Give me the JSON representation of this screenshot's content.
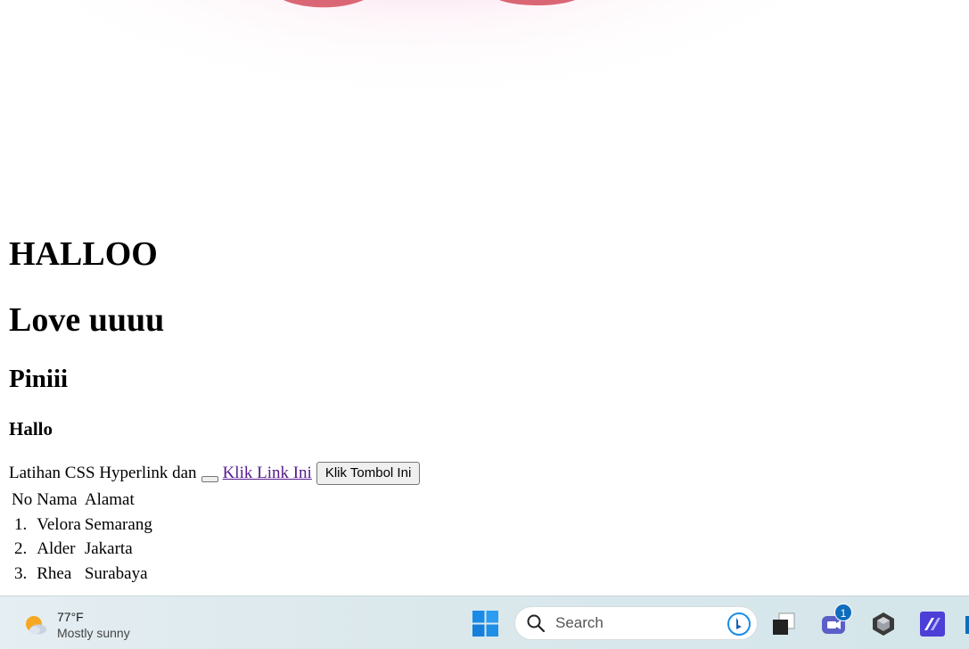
{
  "page": {
    "heading1": "HALLOO",
    "heading2": "Love uuuu",
    "heading3": "Piniii",
    "heading4": "Hallo",
    "intro_text": "Latihan CSS Hyperlink dan",
    "link_text": "Klik Link Ini",
    "button_label": "Klik Tombol Ini",
    "table": {
      "headers": [
        "No",
        "Nama",
        "Alamat"
      ],
      "rows": [
        [
          "1.",
          "Velora",
          "Semarang"
        ],
        [
          "2.",
          "Alder",
          "Jakarta"
        ],
        [
          "3.",
          "Rhea",
          "Surabaya"
        ]
      ]
    }
  },
  "taskbar": {
    "weather": {
      "temperature": "77°F",
      "condition": "Mostly sunny",
      "icon": "partly-sunny-icon"
    },
    "search_placeholder": "Search",
    "chat_badge": "1",
    "icons": [
      "windows-start-icon",
      "search-icon",
      "bing-icon",
      "task-view-icon",
      "teams-chat-icon",
      "app-icon",
      "visual-studio-icon"
    ]
  },
  "colors": {
    "link_visited": "#551a8b",
    "taskbar_bg": "#dbe8ec",
    "accent_blue": "#0f6cbd",
    "hero_pink": "#e27aa8"
  }
}
